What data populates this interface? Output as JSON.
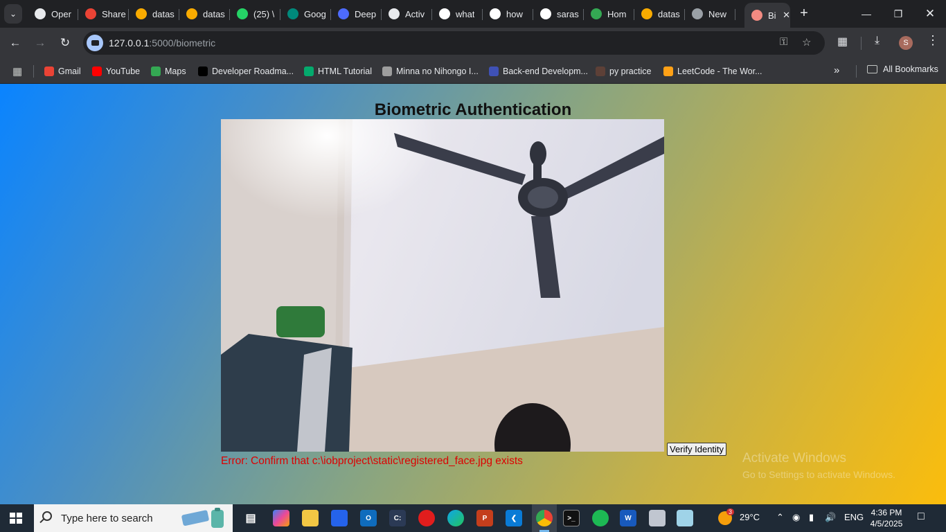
{
  "browser": {
    "tabs": [
      {
        "label": "Oper",
        "favicon": "openai-icon",
        "color": "#e8eaed"
      },
      {
        "label": "Share",
        "favicon": "gmail-icon",
        "color": "#ea4335"
      },
      {
        "label": "datas",
        "favicon": "colab-icon",
        "color": "#f9ab00"
      },
      {
        "label": "datas",
        "favicon": "colab-icon",
        "color": "#f9ab00"
      },
      {
        "label": "(25) \\",
        "favicon": "whatsapp-icon",
        "color": "#25d366"
      },
      {
        "label": "Goog",
        "favicon": "google-meet-icon",
        "color": "#00897b"
      },
      {
        "label": "Deep",
        "favicon": "deepseek-icon",
        "color": "#4d6bfe"
      },
      {
        "label": "Activ",
        "favicon": "openai-icon",
        "color": "#e8eaed"
      },
      {
        "label": "what",
        "favicon": "google-icon",
        "color": "#ffffff"
      },
      {
        "label": "how",
        "favicon": "google-icon",
        "color": "#ffffff"
      },
      {
        "label": "saras",
        "favicon": "github-icon",
        "color": "#ffffff"
      },
      {
        "label": "Hom",
        "favicon": "google-drive-icon",
        "color": "#34a853"
      },
      {
        "label": "datas",
        "favicon": "colab-icon",
        "color": "#f9ab00"
      },
      {
        "label": "New",
        "favicon": "chrome-icon",
        "color": "#9aa0a6"
      },
      {
        "label": "Bi",
        "favicon": "recording-icon",
        "color": "#f28b82"
      }
    ],
    "address": {
      "host": "127.0.0.1",
      "path": ":5000/biometric"
    },
    "bookmarks": [
      {
        "label": "Gmail",
        "icon": "gmail-icon",
        "color": "#ea4335"
      },
      {
        "label": "YouTube",
        "icon": "youtube-icon",
        "color": "#ff0000"
      },
      {
        "label": "Maps",
        "icon": "maps-icon",
        "color": "#34a853"
      },
      {
        "label": "Developer Roadma...",
        "icon": "roadmap-icon",
        "color": "#000000"
      },
      {
        "label": "HTML Tutorial",
        "icon": "w3schools-icon",
        "color": "#04aa6d"
      },
      {
        "label": "Minna no Nihongo I...",
        "icon": "book-icon",
        "color": "#9e9e9e"
      },
      {
        "label": "Back-end Developm...",
        "icon": "course-icon",
        "color": "#3f51b5"
      },
      {
        "label": "py practice",
        "icon": "cc-icon",
        "color": "#5d4037"
      },
      {
        "label": "LeetCode - The Wor...",
        "icon": "leetcode-icon",
        "color": "#ffa116"
      }
    ],
    "all_bookmarks_label": "All Bookmarks",
    "profile_initial": "S"
  },
  "page": {
    "title": "Biometric Authentication",
    "verify_button": "Verify Identity",
    "error": "Error: Confirm that c:\\iobproject\\static\\registered_face.jpg exists"
  },
  "watermark": {
    "title": "Activate Windows",
    "subtitle": "Go to Settings to activate Windows."
  },
  "taskbar": {
    "search_placeholder": "Type here to search",
    "weather": "29°C",
    "weather_badge": "3",
    "language": "ENG",
    "time": "4:36 PM",
    "date": "4/5/2025"
  }
}
